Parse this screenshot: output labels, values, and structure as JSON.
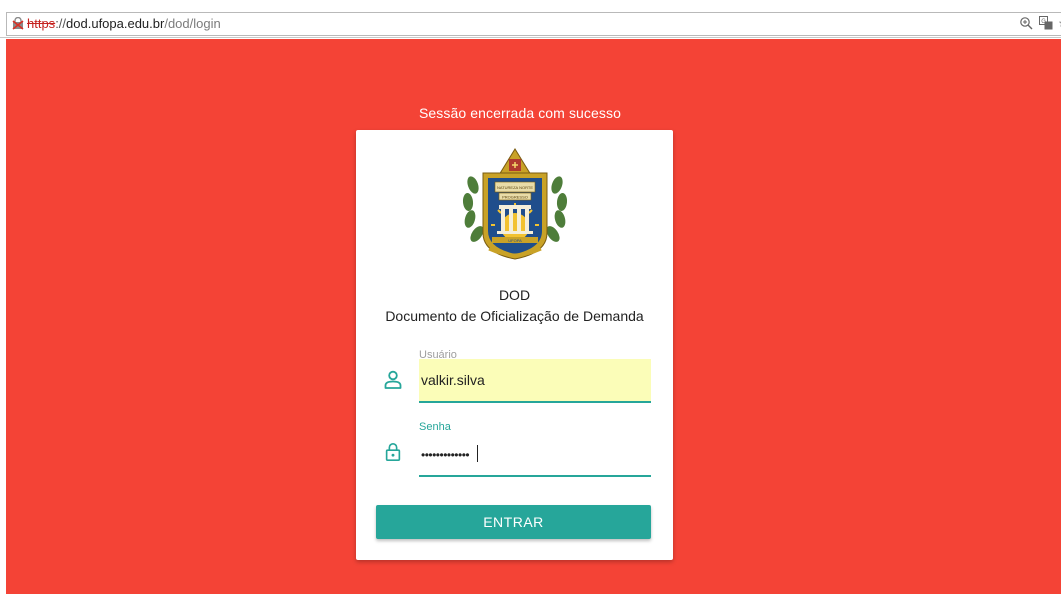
{
  "browser": {
    "url_scheme": "https",
    "url_separator": "://",
    "url_host": "dod.ufopa.edu.br",
    "url_path": "/dod/login",
    "icons": [
      "insecure-lock-icon",
      "zoom-icon",
      "translate-icon",
      "bookmark-star-icon"
    ]
  },
  "page": {
    "background_color": "#f44336",
    "status_message": "Sessão encerrada com sucesso"
  },
  "login_card": {
    "logo_icon": "ufopa-seal-logo",
    "logo_text": [
      "NATUREZA NORTE",
      "PROGRESSO",
      "UFOPA"
    ],
    "acronym": "DOD",
    "title": "Documento de Oficialização de Demanda",
    "username": {
      "label": "Usuário",
      "value": "valkir.silva",
      "icon": "user-icon"
    },
    "password": {
      "label": "Senha",
      "masked_value": "•••••••••••••",
      "icon": "lock-icon"
    },
    "submit_label": "ENTRAR",
    "accent_color": "#26a69a",
    "autofill_color": "#fbfdb8"
  }
}
